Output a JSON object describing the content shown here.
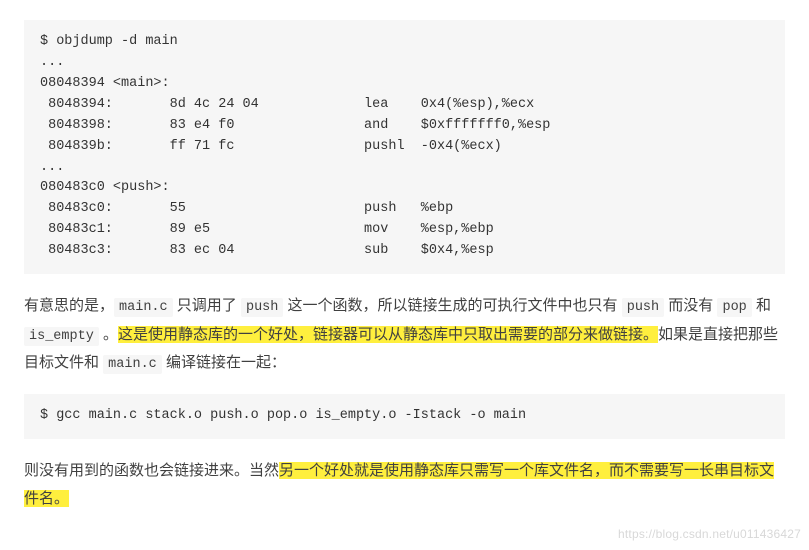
{
  "code1": "$ objdump -d main\n...\n08048394 <main>:\n 8048394:       8d 4c 24 04             lea    0x4(%esp),%ecx\n 8048398:       83 e4 f0                and    $0xfffffff0,%esp\n 804839b:       ff 71 fc                pushl  -0x4(%ecx)\n...\n080483c0 <push>:\n 80483c0:       55                      push   %ebp\n 80483c1:       89 e5                   mov    %esp,%ebp\n 80483c3:       83 ec 04                sub    $0x4,%esp",
  "p1": {
    "t1": "有意思的是，",
    "c1": "main.c",
    "t2": " 只调用了 ",
    "c2": "push",
    "t3": " 这一个函数，所以链接生成的可执行文件中也只有 ",
    "c3": "push",
    "t4": " 而没有 ",
    "c4": "pop",
    "t5": " 和 ",
    "c5": "is_empty",
    "t6": " 。",
    "h1": "这是使用静态库的一个好处，链接器可以从静态库中只取出需要的部分来做链接。",
    "t7": "如果是直接把那些目标文件和 ",
    "c6": "main.c",
    "t8": " 编译链接在一起："
  },
  "code2": "$ gcc main.c stack.o push.o pop.o is_empty.o -Istack -o main",
  "p2": {
    "t1": "则没有用到的函数也会链接进来。当然",
    "h1": "另一个好处就是使用静态库只需写一个库文件名，而不需要写一长串目标文件名。"
  },
  "watermark": "https://blog.csdn.net/u011436427"
}
